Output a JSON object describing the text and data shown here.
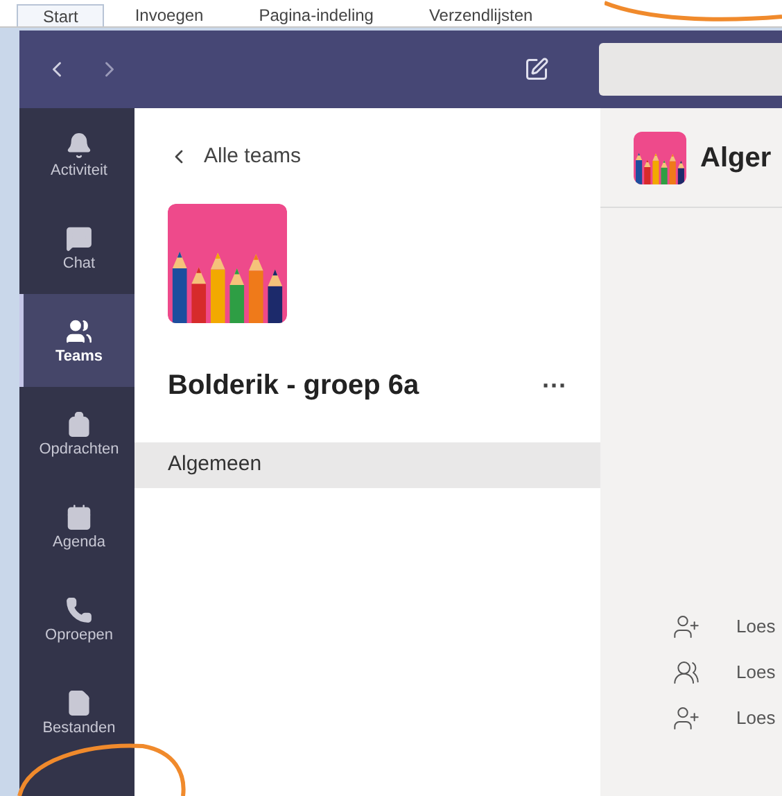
{
  "ribbon_tabs": [
    {
      "label": "Start",
      "selected": true
    },
    {
      "label": "Invoegen",
      "selected": false
    },
    {
      "label": "Pagina-indeling",
      "selected": false
    },
    {
      "label": "Verzendlijsten",
      "selected": false
    }
  ],
  "rail": [
    {
      "kind": "bell",
      "label": "Activiteit",
      "selected": false
    },
    {
      "kind": "chat",
      "label": "Chat",
      "selected": false
    },
    {
      "kind": "teams",
      "label": "Teams",
      "selected": true
    },
    {
      "kind": "backpack",
      "label": "Opdrachten",
      "selected": false
    },
    {
      "kind": "calendar",
      "label": "Agenda",
      "selected": false
    },
    {
      "kind": "phone",
      "label": "Oproepen",
      "selected": false
    },
    {
      "kind": "file",
      "label": "Bestanden",
      "selected": false
    }
  ],
  "team_panel": {
    "back_link": "Alle teams",
    "team_name": "Bolderik - groep 6a",
    "more": "···",
    "channels": [
      {
        "label": "Algemeen",
        "selected": true
      }
    ]
  },
  "channel": {
    "title": "Alger",
    "activity": [
      {
        "kind": "person-add",
        "text": "Loes"
      },
      {
        "kind": "team",
        "text": "Loes"
      },
      {
        "kind": "person-add",
        "text": "Loes"
      }
    ]
  }
}
